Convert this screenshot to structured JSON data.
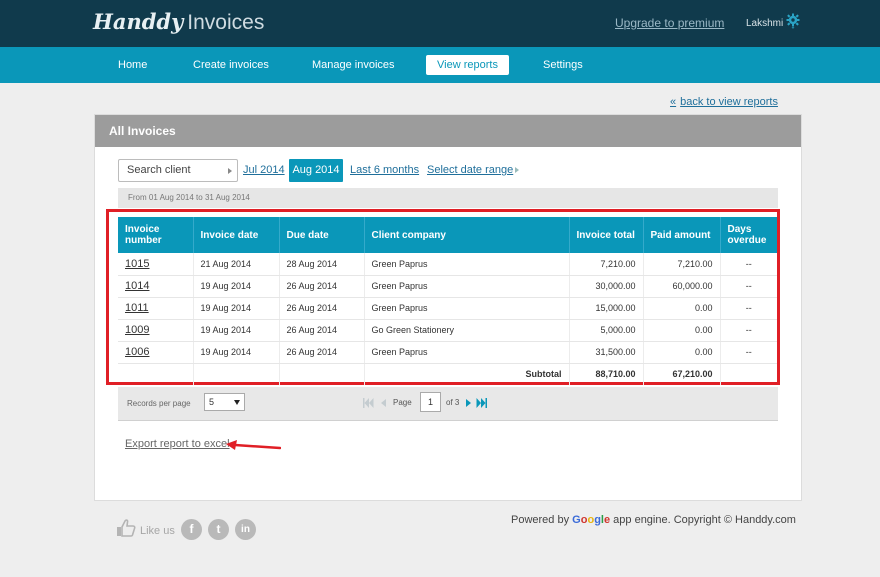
{
  "brand": {
    "logo_script": "Handdy",
    "logo_plain": "Invoices"
  },
  "header": {
    "upgrade_label": "Upgrade to premium",
    "user_name": "Lakshmi",
    "settings_icon": "gear-icon"
  },
  "nav": {
    "items": [
      {
        "label": "Home",
        "active": false
      },
      {
        "label": "Create invoices",
        "active": false
      },
      {
        "label": "Manage invoices",
        "active": false
      },
      {
        "label": "View reports",
        "active": true
      },
      {
        "label": "Settings",
        "active": false
      }
    ]
  },
  "back_link": {
    "chevron": "«",
    "label": "back to view reports"
  },
  "panel": {
    "title": "All Invoices",
    "search_placeholder": "Search client",
    "ranges": {
      "jul": "Jul 2014",
      "aug": "Aug 2014",
      "last6": "Last 6 months",
      "select": "Select date range"
    },
    "date_range_text": "From 01 Aug 2014 to 31 Aug 2014"
  },
  "table": {
    "headers": {
      "invoice_number": "Invoice number",
      "invoice_date": "Invoice date",
      "due_date": "Due date",
      "client_company": "Client company",
      "invoice_total": "Invoice total",
      "paid_amount": "Paid amount",
      "days_overdue": "Days overdue"
    },
    "rows": [
      {
        "number": "1015",
        "invoice_date": "21 Aug 2014",
        "due_date": "28 Aug 2014",
        "client": "Green Paprus",
        "total": "7,210.00",
        "paid": "7,210.00",
        "overdue": "--"
      },
      {
        "number": "1014",
        "invoice_date": "19 Aug 2014",
        "due_date": "26 Aug 2014",
        "client": "Green Paprus",
        "total": "30,000.00",
        "paid": "60,000.00",
        "overdue": "--"
      },
      {
        "number": "1011",
        "invoice_date": "19 Aug 2014",
        "due_date": "26 Aug 2014",
        "client": "Green Paprus",
        "total": "15,000.00",
        "paid": "0.00",
        "overdue": "--"
      },
      {
        "number": "1009",
        "invoice_date": "19 Aug 2014",
        "due_date": "26 Aug 2014",
        "client": "Go Green Stationery",
        "total": "5,000.00",
        "paid": "0.00",
        "overdue": "--"
      },
      {
        "number": "1006",
        "invoice_date": "19 Aug 2014",
        "due_date": "26 Aug 2014",
        "client": "Green Paprus",
        "total": "31,500.00",
        "paid": "0.00",
        "overdue": "--"
      }
    ],
    "subtotal": {
      "label": "Subtotal",
      "total": "88,710.00",
      "paid": "67,210.00"
    }
  },
  "pagination": {
    "records_label": "Records per page",
    "records_value": "5",
    "page_label": "Page",
    "page_value": "1",
    "of_label": "of 3"
  },
  "export": {
    "label": "Export report to excel"
  },
  "footer": {
    "like_us": "Like us",
    "social": {
      "facebook": "f",
      "twitter": "t",
      "linkedin": "in"
    },
    "powered_prefix": "Powered by ",
    "google": "Google",
    "powered_suffix": " app engine. Copyright © Handdy.com"
  },
  "colors": {
    "header_bg": "#103a4c",
    "nav_bg": "#0a97b9",
    "accent": "#0a97b9",
    "highlight_red": "#e01f26"
  }
}
